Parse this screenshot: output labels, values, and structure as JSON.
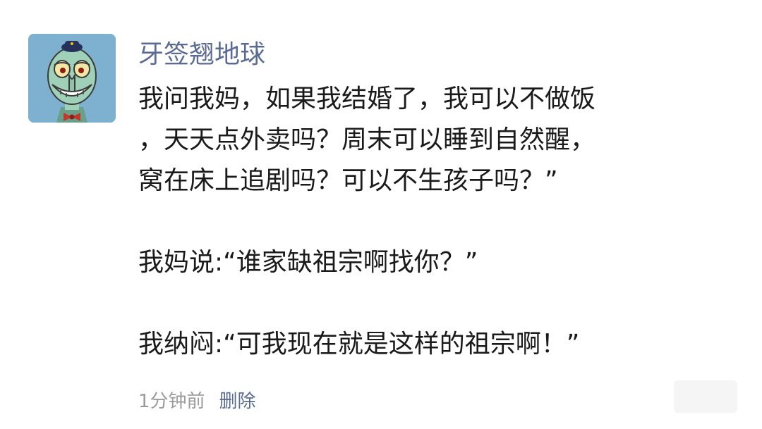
{
  "post": {
    "author": "牙签翘地球",
    "lines": [
      "我问我妈，如果我结婚了，我可以不做饭",
      "，天天点外卖吗？周末可以睡到自然醒，",
      "窝在床上追剧吗？可以不生孩子吗？”",
      "我妈说:“谁家缺祖宗啊找你？”",
      "我纳闷:“可我现在就是这样的祖宗啊！”"
    ],
    "time": "1分钟前",
    "delete_label": "删除"
  },
  "avatar": {
    "icon": "squidward-avatar-icon",
    "background": "#7eb0cf"
  },
  "colors": {
    "nickname": "#5b6b92",
    "text": "#1a1a1a",
    "time": "#9b9b9b",
    "link": "#5b6b92"
  }
}
